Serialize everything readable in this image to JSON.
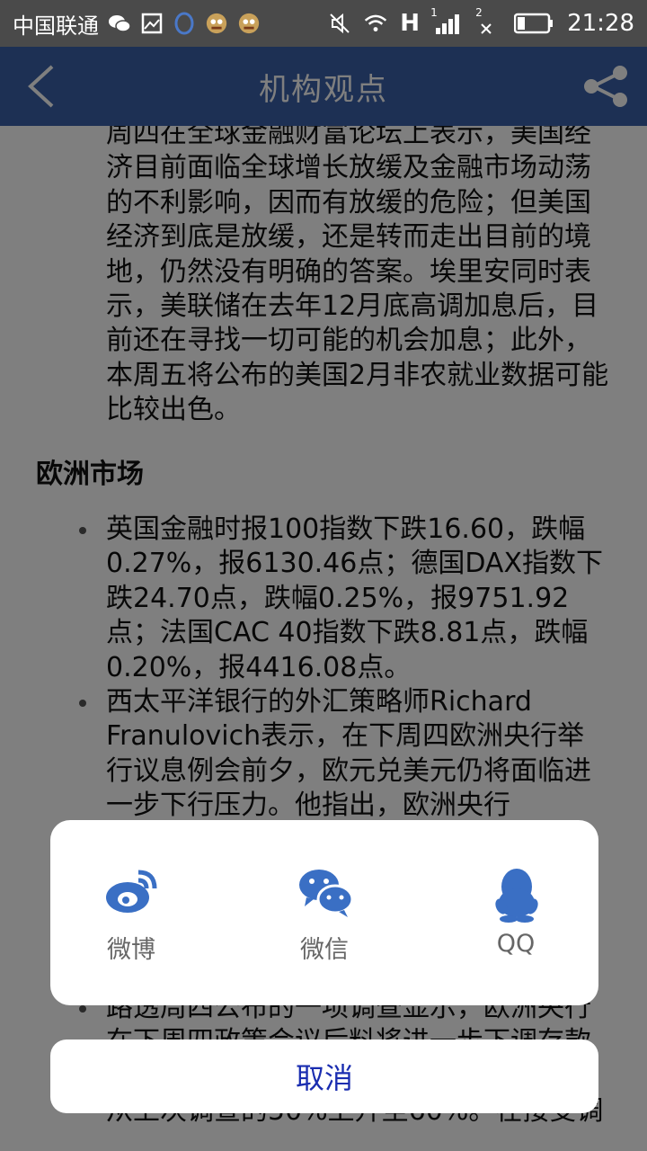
{
  "status_bar": {
    "carrier": "中国联通",
    "time": "21:28",
    "signal_1_label": "1",
    "signal_2_label": "2",
    "network_label": "H",
    "icons": [
      "wechat-icon",
      "gallery-icon",
      "ring-icon",
      "app-avatar-icon",
      "app-avatar-icon",
      "mute-icon",
      "wifi-icon",
      "signal-icon",
      "battery-icon"
    ]
  },
  "app_bar": {
    "title": "机构观点",
    "back_icon": "chevron-left-icon",
    "share_icon": "share-icon",
    "color": "#3a61a8"
  },
  "article": {
    "intro": "周四在全球金融财富论坛上表示，美国经济目前面临全球增长放缓及金融市场动荡的不利影响，因而有放缓的危险；但美国经济到底是放缓，还是转而走出目前的境地，仍然没有明确的答案。埃里安同时表示，美联储在去年12月底高调加息后，目前还在寻找一切可能的机会加息；此外，本周五将公布的美国2月非农就业数据可能比较出色。",
    "section_title": "欧洲市场",
    "bullets": [
      "英国金融时报100指数下跌16.60，跌幅0.27%，报6130.46点；德国DAX指数下跌24.70点，跌幅0.25%，报9751.92点；法国CAC 40指数下跌8.81点，跌幅0.20%，报4416.08点。",
      "西太平洋银行的外汇策略师Richard Franulovich表示，在下周四欧洲央行举行议息例会前夕，欧元兑美元仍将面临进一步下行压力。他指出，欧洲央行",
      "路透周四公布的一项调查显示，欧洲央行在下周四政策会议后料将进一步下调存款利率，并将继续扩大资产购买规模的几率从上次调查的50%上升至60%。在接受调"
    ]
  },
  "share_sheet": {
    "items": [
      {
        "label": "微博",
        "icon": "weibo-icon"
      },
      {
        "label": "微信",
        "icon": "wechat-icon"
      },
      {
        "label": "QQ",
        "icon": "qq-icon"
      }
    ],
    "cancel_label": "取消",
    "accent": "#3a6fc4",
    "cancel_color": "#1a2db0"
  }
}
